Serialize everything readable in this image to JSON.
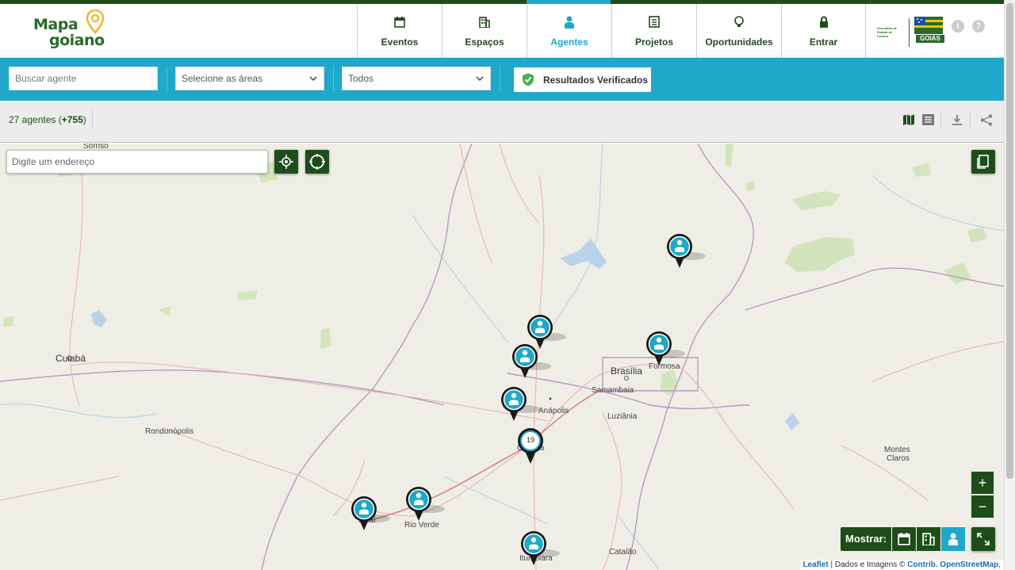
{
  "app": {
    "logo_line1": "Mapa",
    "logo_line2": "goiano",
    "gov_small": "Secretaria de Estado de Cultura",
    "gov_state": "GOIÁS"
  },
  "nav": {
    "items": [
      {
        "label": "Eventos",
        "icon": "calendar-icon"
      },
      {
        "label": "Espaços",
        "icon": "building-icon"
      },
      {
        "label": "Agentes",
        "icon": "person-icon",
        "active": true
      },
      {
        "label": "Projetos",
        "icon": "document-icon"
      },
      {
        "label": "Oportunidades",
        "icon": "lightbulb-icon"
      },
      {
        "label": "Entrar",
        "icon": "lock-icon"
      }
    ],
    "info_glyph": "i",
    "help_glyph": "?"
  },
  "filters": {
    "search_placeholder": "Buscar agente",
    "areas_placeholder": "Selecione as áreas",
    "type_value": "Todos",
    "verified_label": "Resultados Verificados"
  },
  "results": {
    "count_text": "27 agentes (",
    "count_extra": "+755",
    "count_close": ")"
  },
  "map": {
    "address_placeholder": "Digite um endereço",
    "show_label": "Mostrar:",
    "zoom_in": "+",
    "zoom_out": "−",
    "cluster_count": "19",
    "attribution": {
      "leaflet": "Leaflet",
      "middle": " | Dados e Imagens © ",
      "contrib": "Contrib. OpenStreetMap",
      "end": ","
    },
    "cities": [
      {
        "name": "Sorriso",
        "big": false
      },
      {
        "name": "Cuiabá",
        "big": true
      },
      {
        "name": "Rondonópolis",
        "big": false
      },
      {
        "name": "Brasília",
        "big": true
      },
      {
        "name": "Formosa",
        "big": false
      },
      {
        "name": "Samambaia",
        "big": false
      },
      {
        "name": "Anápolis",
        "big": false
      },
      {
        "name": "Luziânia",
        "big": false
      },
      {
        "name": "Goiânia",
        "big": false
      },
      {
        "name": "Jataí",
        "big": false
      },
      {
        "name": "Rio Verde",
        "big": false
      },
      {
        "name": "Montes",
        "big": false
      },
      {
        "name": "Claros",
        "big": false
      },
      {
        "name": "Catalão",
        "big": false
      },
      {
        "name": "Itumbiara",
        "big": false
      }
    ]
  },
  "colors": {
    "primary_green": "#1f4d1a",
    "accent_blue": "#1fa8c9",
    "verified_green": "#4caf50"
  }
}
